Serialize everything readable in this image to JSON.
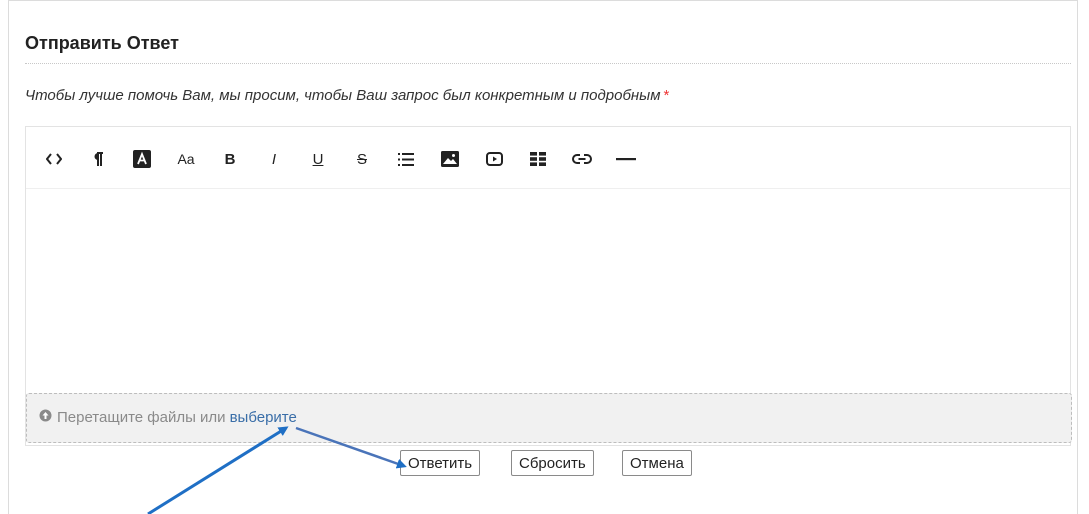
{
  "form": {
    "title": "Отправить Ответ",
    "instruction": "Чтобы лучше помочь Вам, мы просим, чтобы Ваш запрос был конкретным и подробным",
    "required_mark": "*"
  },
  "toolbar": {
    "buttons": [
      {
        "name": "code-view",
        "icon": "code-icon"
      },
      {
        "name": "paragraph-format",
        "icon": "paragraph-icon"
      },
      {
        "name": "text-color",
        "icon": "text-color-icon"
      },
      {
        "name": "font-size",
        "icon": "font-size-icon",
        "label": "Aa"
      },
      {
        "name": "bold",
        "icon": "bold-icon",
        "label": "B"
      },
      {
        "name": "italic",
        "icon": "italic-icon",
        "label": "I"
      },
      {
        "name": "underline",
        "icon": "underline-icon",
        "label": "U"
      },
      {
        "name": "strikethrough",
        "icon": "strikethrough-icon",
        "label": "S"
      },
      {
        "name": "list",
        "icon": "list-icon"
      },
      {
        "name": "insert-image",
        "icon": "image-icon"
      },
      {
        "name": "insert-video",
        "icon": "video-icon"
      },
      {
        "name": "insert-table",
        "icon": "table-icon"
      },
      {
        "name": "insert-link",
        "icon": "link-icon"
      },
      {
        "name": "horizontal-line",
        "icon": "horizontal-line-icon"
      }
    ]
  },
  "dropzone": {
    "icon": "upload-icon",
    "text": "Перетащите файлы или",
    "link": "выберите"
  },
  "actions": {
    "submit": "Ответить",
    "reset": "Сбросить",
    "cancel": "Отмена"
  },
  "colors": {
    "required": "#e33333",
    "link": "#3a6ea8",
    "annotation_arrow": "#1f6fc5"
  }
}
